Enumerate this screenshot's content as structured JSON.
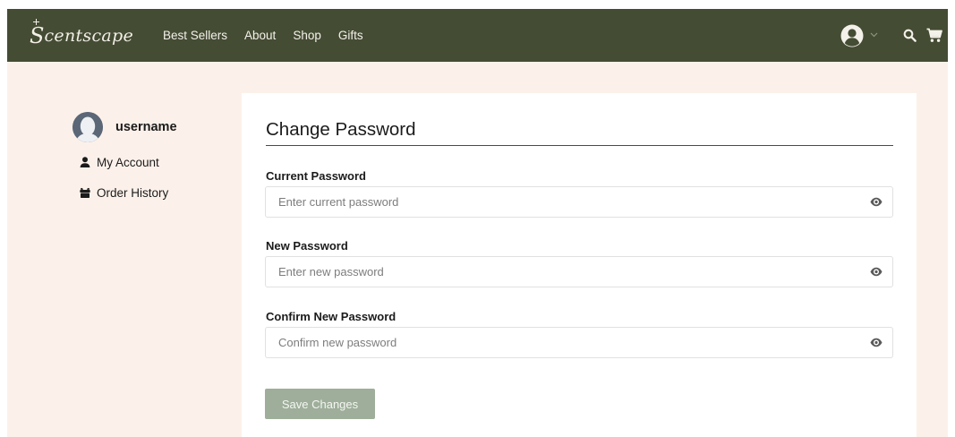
{
  "brand": {
    "logo_text": "Scentscape",
    "logo_first": "S",
    "logo_rest": "centscape"
  },
  "nav": {
    "links": [
      "Best Sellers",
      "About",
      "Shop",
      "Gifts"
    ],
    "icons": [
      "user-circle-icon",
      "chevron-down-icon",
      "search-icon",
      "cart-icon"
    ]
  },
  "sidebar": {
    "username": "username",
    "items": [
      {
        "label": "My Account",
        "icon": "person-icon"
      },
      {
        "label": "Order History",
        "icon": "gift-icon"
      }
    ]
  },
  "form": {
    "title": "Change Password",
    "fields": [
      {
        "label": "Current Password",
        "placeholder": "Enter current password",
        "value": ""
      },
      {
        "label": "New Password",
        "placeholder": "Enter new password",
        "value": ""
      },
      {
        "label": "Confirm New Password",
        "placeholder": "Confirm new password",
        "value": ""
      }
    ],
    "submit_label": "Save Changes"
  },
  "colors": {
    "nav_bg": "#444c34",
    "page_bg": "#fcf1ea",
    "button_bg": "#9eae9a"
  }
}
